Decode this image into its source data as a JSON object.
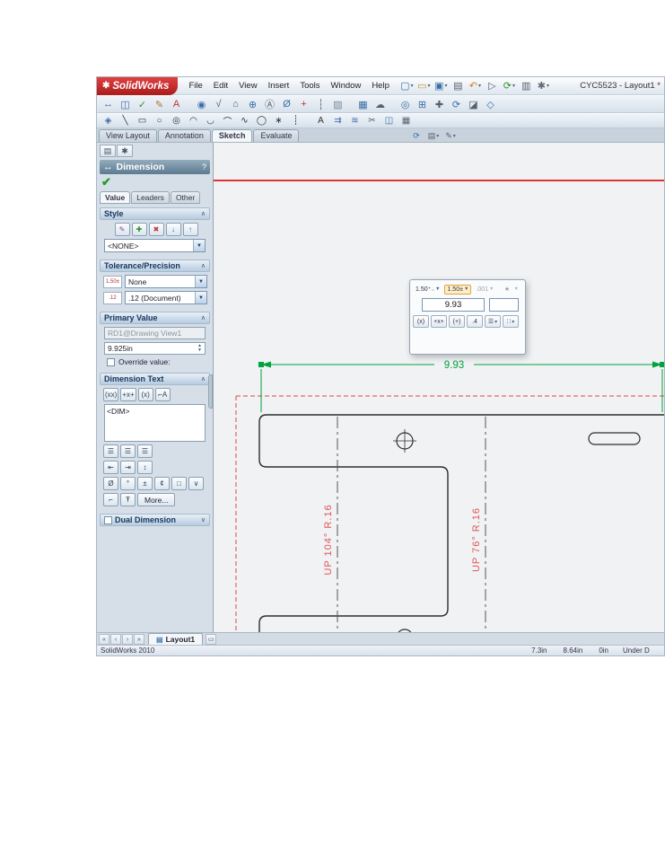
{
  "window": {
    "app_name": "SolidWorks",
    "title": "CYC5523 - Layout1 *",
    "menus": [
      {
        "name": "menu-file",
        "label": "File"
      },
      {
        "name": "menu-edit",
        "label": "Edit"
      },
      {
        "name": "menu-view",
        "label": "View"
      },
      {
        "name": "menu-insert",
        "label": "Insert"
      },
      {
        "name": "menu-tools",
        "label": "Tools"
      },
      {
        "name": "menu-window",
        "label": "Window"
      },
      {
        "name": "menu-help",
        "label": "Help"
      }
    ],
    "quick_toolbar": [
      {
        "name": "new-document-icon",
        "glyph": "▢",
        "color": "#3a6ea8",
        "caret": true
      },
      {
        "name": "open-document-icon",
        "glyph": "▭",
        "color": "#c29a2a",
        "caret": true
      },
      {
        "name": "save-icon",
        "glyph": "▣",
        "color": "#3a6ea8",
        "caret": true
      },
      {
        "name": "print-icon",
        "glyph": "▤",
        "color": "#556070"
      },
      {
        "name": "undo-icon",
        "glyph": "↶",
        "color": "#d08020",
        "caret": true
      },
      {
        "name": "select-icon",
        "glyph": "▷",
        "color": "#556070"
      },
      {
        "name": "rebuild-icon",
        "glyph": "⟳",
        "color": "#2f8f2f",
        "caret": true
      },
      {
        "name": "file-properties-icon",
        "glyph": "▥",
        "color": "#556070"
      },
      {
        "name": "options-icon",
        "glyph": "✱",
        "color": "#667",
        "caret": true
      }
    ]
  },
  "toolbars": {
    "row2": [
      {
        "name": "smart-dimension-icon",
        "glyph": "↔",
        "color": "#3a6ea8"
      },
      {
        "name": "model-items-icon",
        "glyph": "◫",
        "color": "#3a6ea8"
      },
      {
        "name": "spell-checker-icon",
        "glyph": "✓",
        "color": "#2f8f2f"
      },
      {
        "name": "format-painter-icon",
        "glyph": "✎",
        "color": "#a8772a"
      },
      {
        "name": "note-icon",
        "glyph": "A",
        "color": "#c23333"
      },
      {
        "name": "balloon-icon",
        "glyph": "◉",
        "color": "#3a6ea8",
        "class": "gap"
      },
      {
        "name": "surface-finish-icon",
        "glyph": "√",
        "color": "#556070"
      },
      {
        "name": "weld-symbol-icon",
        "glyph": "⌂",
        "color": "#556070"
      },
      {
        "name": "geometric-tolerance-icon",
        "glyph": "⊕",
        "color": "#3a6ea8"
      },
      {
        "name": "datum-feature-icon",
        "glyph": "Ⓐ",
        "color": "#556070"
      },
      {
        "name": "hole-callout-icon",
        "glyph": "Ø",
        "color": "#3a6ea8"
      },
      {
        "name": "center-mark-icon",
        "glyph": "+",
        "color": "#c23333"
      },
      {
        "name": "centerline-icon",
        "glyph": "┆",
        "color": "#556070"
      },
      {
        "name": "area-hatch-icon",
        "glyph": "▨",
        "color": "#7a8aa0"
      },
      {
        "name": "table-icon",
        "glyph": "▦",
        "color": "#3a6ea8",
        "class": "gap"
      },
      {
        "name": "revision-cloud-icon",
        "glyph": "☁",
        "color": "#556070"
      },
      {
        "name": "zoom-to-fit-icon",
        "glyph": "◎",
        "color": "#3a6ea8",
        "class": "gap"
      },
      {
        "name": "zoom-to-area-icon",
        "glyph": "⊞",
        "color": "#3a6ea8"
      },
      {
        "name": "pan-icon",
        "glyph": "✚",
        "color": "#556070"
      },
      {
        "name": "rotate-view-icon",
        "glyph": "⟳",
        "color": "#3a6ea8"
      },
      {
        "name": "section-view-icon",
        "glyph": "◪",
        "color": "#556070"
      },
      {
        "name": "display-style-icon",
        "glyph": "◇",
        "color": "#3a6ea8"
      }
    ],
    "row3": [
      {
        "name": "sketch-smart-dimension-icon",
        "glyph": "◈",
        "color": "#3a6ea8"
      },
      {
        "name": "line-icon",
        "glyph": "╲",
        "color": "#333"
      },
      {
        "name": "rectangle-icon",
        "glyph": "▭",
        "color": "#333"
      },
      {
        "name": "circle-icon",
        "glyph": "○",
        "color": "#333"
      },
      {
        "name": "perimeter-circle-icon",
        "glyph": "◎",
        "color": "#333"
      },
      {
        "name": "centerpoint-arc-icon",
        "glyph": "◠",
        "color": "#333"
      },
      {
        "name": "tangent-arc-icon",
        "glyph": "◡",
        "color": "#333"
      },
      {
        "name": "three-point-arc-icon",
        "glyph": "⌒",
        "color": "#333"
      },
      {
        "name": "spline-icon",
        "glyph": "∿",
        "color": "#333"
      },
      {
        "name": "ellipse-icon",
        "glyph": "◯",
        "color": "#333"
      },
      {
        "name": "point-icon",
        "glyph": "∗",
        "color": "#333"
      },
      {
        "name": "centerline-sketch-icon",
        "glyph": "┊",
        "color": "#333"
      },
      {
        "name": "text-icon",
        "glyph": "A",
        "color": "#333",
        "class": "gap"
      },
      {
        "name": "convert-entities-icon",
        "glyph": "⇉",
        "color": "#3a6ea8"
      },
      {
        "name": "offset-entities-icon",
        "glyph": "≋",
        "color": "#3a6ea8"
      },
      {
        "name": "trim-entities-icon",
        "glyph": "✂",
        "color": "#556070"
      },
      {
        "name": "mirror-entities-icon",
        "glyph": "◫",
        "color": "#3a6ea8"
      },
      {
        "name": "linear-pattern-icon",
        "glyph": "▦",
        "color": "#556070"
      }
    ],
    "view_tools": [
      {
        "name": "refresh-view-icon",
        "glyph": "⟳",
        "color": "#3a6ea8"
      },
      {
        "name": "sheet-properties-icon",
        "glyph": "▤",
        "color": "#556070",
        "caret": true
      },
      {
        "name": "annotation-filter-icon",
        "glyph": "✎",
        "color": "#556070",
        "caret": true
      }
    ]
  },
  "command_tabs": {
    "view_layout": "View Layout",
    "annotation": "Annotation",
    "sketch": "Sketch",
    "evaluate": "Evaluate"
  },
  "property_manager": {
    "title": "Dimension",
    "help": "?",
    "ok_glyph": "✔",
    "tabs": {
      "value": "Value",
      "leaders": "Leaders",
      "other": "Other"
    },
    "style": {
      "label": "Style",
      "chevron": "∧",
      "buttons": [
        {
          "name": "apply-default-style-button",
          "glyph": "✎",
          "color": "#7a4a9a"
        },
        {
          "name": "add-style-button",
          "glyph": "✚",
          "color": "#2f8f2f"
        },
        {
          "name": "delete-style-button",
          "glyph": "✖",
          "color": "#c23333"
        },
        {
          "name": "save-style-button",
          "glyph": "↓",
          "color": "#3a6ea8"
        },
        {
          "name": "load-style-button",
          "glyph": "↑",
          "color": "#3a6ea8"
        }
      ],
      "dropdown_value": "<NONE>"
    },
    "tolerance": {
      "label": "Tolerance/Precision",
      "chevron": "∧",
      "tolerance_icon": "1.50±",
      "tolerance_value": "None",
      "precision_icon": ".12",
      "precision_value": ".12 (Document)"
    },
    "primary_value": {
      "label": "Primary Value",
      "chevron": "∧",
      "reference": "RD1@Drawing View1",
      "value": "9.925in",
      "override_label": "Override value:"
    },
    "dimension_text": {
      "label": "Dimension Text",
      "chevron": "∧",
      "text_buttons": [
        {
          "name": "add-parenthesis-button",
          "glyph": "(xx)"
        },
        {
          "name": "center-dimension-button",
          "glyph": "+x+"
        },
        {
          "name": "offset-text-button",
          "glyph": "(x)"
        },
        {
          "name": "dimension-leader-button",
          "glyph": "⌐A"
        }
      ],
      "text_value": "<DIM>",
      "justify_buttons": [
        {
          "name": "left-justify-button",
          "glyph": "☰"
        },
        {
          "name": "center-justify-button",
          "glyph": "☰"
        },
        {
          "name": "right-justify-button",
          "glyph": "☰"
        }
      ],
      "position_buttons": [
        {
          "name": "break-line-button",
          "glyph": "⇤"
        },
        {
          "name": "align-text-button",
          "glyph": "⇥"
        },
        {
          "name": "vertical-position-button",
          "glyph": "↕"
        }
      ],
      "symbol_buttons": [
        {
          "name": "diameter-symbol-button",
          "glyph": "Ø"
        },
        {
          "name": "degree-symbol-button",
          "glyph": "°"
        },
        {
          "name": "plus-minus-symbol-button",
          "glyph": "±"
        },
        {
          "name": "centerline-symbol-button",
          "glyph": "¢"
        },
        {
          "name": "square-symbol-button",
          "glyph": "□"
        },
        {
          "name": "more-symbols-button",
          "glyph": "∨"
        }
      ],
      "extra_buttons": [
        {
          "name": "counterbore-symbol-button",
          "glyph": "⌐"
        },
        {
          "name": "depth-symbol-button",
          "glyph": "Ŧ"
        }
      ],
      "more_label": "More..."
    },
    "dual_dimension": {
      "label": "Dual Dimension",
      "chevron": "∨"
    }
  },
  "dimension_palette": {
    "tolerance_buttons": {
      "b1": "1.50⁺₋",
      "b2": "1.50±",
      "b3": ".001",
      "b4": "★"
    },
    "value": "9.93",
    "secondary_value": "",
    "style_buttons": [
      {
        "name": "inspection-dimension-button",
        "glyph": "(x)"
      },
      {
        "name": "center-dimension-button",
        "glyph": "+x+"
      },
      {
        "name": "offset-text-button",
        "glyph": "(+)"
      },
      {
        "name": "text-scale-button",
        "glyph": ".4"
      },
      {
        "name": "justify-button",
        "glyph": "☰",
        "caret": true
      },
      {
        "name": "grip-settings-button",
        "glyph": "∷",
        "caret": true
      }
    ]
  },
  "canvas": {
    "dimension_value": "9.93",
    "bend_notes": [
      "UP 104° R.16",
      "UP 76° R.16"
    ],
    "colors": {
      "dimension": "#00a33e",
      "annotation": "#e05555",
      "sheet_border": "#e04545",
      "edge_red": "#e03434",
      "geometry": "#2e2e2e",
      "bend_line": "#555555"
    }
  },
  "sheet_bar": {
    "nav": [
      {
        "name": "first-sheet-icon",
        "glyph": "«"
      },
      {
        "name": "previous-sheet-icon",
        "glyph": "‹"
      },
      {
        "name": "next-sheet-icon",
        "glyph": "›"
      },
      {
        "name": "last-sheet-icon",
        "glyph": "»"
      }
    ],
    "tab_label": "Layout1"
  },
  "status_bar": {
    "left": "SolidWorks 2010",
    "coords": [
      {
        "name": "x-coordinate",
        "label": "7.3in"
      },
      {
        "name": "y-coordinate",
        "label": "8.64in"
      },
      {
        "name": "z-coordinate",
        "label": "0in"
      }
    ],
    "state": "Under D"
  }
}
